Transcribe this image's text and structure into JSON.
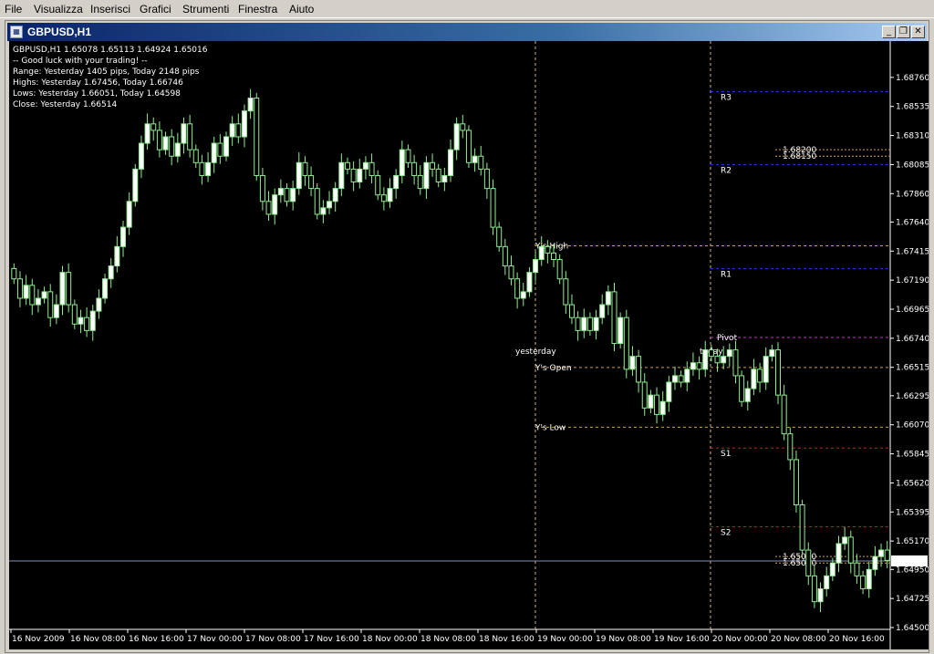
{
  "menu": [
    {
      "label": "File"
    },
    {
      "label": "Visualizza"
    },
    {
      "label": "Inserisci"
    },
    {
      "label": "Grafici"
    },
    {
      "label": "Strumenti"
    },
    {
      "label": "Finestra"
    },
    {
      "label": "Aiuto"
    }
  ],
  "window": {
    "title": "GBPUSD,H1",
    "buttons": {
      "minimize": "_",
      "restore": "❐",
      "close": "✕"
    }
  },
  "info_lines": [
    "GBPUSD,H1  1.65078 1.65113 1.64924 1.65016",
    "-- Good luck with your trading! --",
    "Range: Yesterday 1405 pips, Today 2148 pips",
    "Highs: Yesterday 1.67456, Today 1.66746",
    "Lows:  Yesterday 1.66051, Today 1.64598",
    "Close: Yesterday 1.66514"
  ],
  "colors": {
    "background": "#000000",
    "candle": "#90ee90",
    "bull_body": "#ffffff",
    "resistance": "#1e3cff",
    "support": "#c81e1e",
    "pivot": "#c832c8",
    "yesterday_levels": "#d2a04b",
    "current_price": "#8090c0",
    "separator": "#d2b48c",
    "label_yesterday": "#5f9ea0"
  },
  "chart_data": {
    "type": "candlestick",
    "symbol": "GBPUSD",
    "timeframe": "H1",
    "ylim": [
      1.645,
      1.68985
    ],
    "y_ticks": [
      "1.68760",
      "1.68535",
      "1.68310",
      "1.68085",
      "1.67860",
      "1.67640",
      "1.67415",
      "1.67190",
      "1.66965",
      "1.66740",
      "1.66515",
      "1.66295",
      "1.66070",
      "1.65845",
      "1.65620",
      "1.65395",
      "1.65170",
      "1.64950",
      "1.64725",
      "1.64500"
    ],
    "x_ticks": [
      "16 Nov 2009",
      "16 Nov 08:00",
      "16 Nov 16:00",
      "17 Nov 00:00",
      "17 Nov 08:00",
      "17 Nov 16:00",
      "18 Nov 00:00",
      "18 Nov 08:00",
      "18 Nov 16:00",
      "19 Nov 00:00",
      "19 Nov 08:00",
      "19 Nov 16:00",
      "20 Nov 00:00",
      "20 Nov 08:00",
      "20 Nov 16:00"
    ],
    "last_price": "1.65016",
    "closes": [
      1.672,
      1.6705,
      1.6715,
      1.67,
      1.6705,
      1.671,
      1.669,
      1.67,
      1.6725,
      1.67,
      1.6685,
      1.669,
      1.668,
      1.6695,
      1.6705,
      1.672,
      1.673,
      1.6745,
      1.676,
      1.678,
      1.6805,
      1.6825,
      1.684,
      1.6835,
      1.682,
      1.683,
      1.6815,
      1.6825,
      1.684,
      1.682,
      1.681,
      1.68,
      1.681,
      1.6825,
      1.6815,
      1.683,
      1.684,
      1.683,
      1.685,
      1.686,
      1.68,
      1.678,
      1.677,
      1.6785,
      1.679,
      1.678,
      1.679,
      1.681,
      1.68,
      1.679,
      1.677,
      1.6775,
      1.678,
      1.679,
      1.681,
      1.6805,
      1.6795,
      1.6805,
      1.681,
      1.68,
      1.6785,
      1.678,
      1.679,
      1.68,
      1.682,
      1.681,
      1.68,
      1.679,
      1.681,
      1.6805,
      1.6795,
      1.68,
      1.682,
      1.684,
      1.6835,
      1.681,
      1.6815,
      1.6805,
      1.679,
      1.676,
      1.6745,
      1.673,
      1.672,
      1.6705,
      1.671,
      1.6725,
      1.6735,
      1.6745,
      1.674,
      1.6735,
      1.672,
      1.67,
      1.669,
      1.668,
      1.669,
      1.668,
      1.669,
      1.67,
      1.671,
      1.667,
      1.669,
      1.665,
      1.666,
      1.664,
      1.662,
      1.663,
      1.6615,
      1.6625,
      1.664,
      1.6645,
      1.664,
      1.665,
      1.6655,
      1.665,
      1.6665,
      1.666,
      1.6655,
      1.666,
      1.6665,
      1.6645,
      1.6625,
      1.6635,
      1.665,
      1.664,
      1.666,
      1.6665,
      1.663,
      1.66,
      1.658,
      1.6545,
      1.651,
      1.649,
      1.647,
      1.648,
      1.649,
      1.65,
      1.6515,
      1.652,
      1.65,
      1.649,
      1.648,
      1.6495,
      1.6505,
      1.651,
      1.6502
    ]
  },
  "levels": [
    {
      "label": "R3",
      "value": 1.6865,
      "kind": "resistance"
    },
    {
      "label": "R2",
      "value": 1.68085,
      "kind": "resistance"
    },
    {
      "label": "R1",
      "value": 1.6728,
      "kind": "resistance"
    },
    {
      "label": "Y's High",
      "value": 1.67456,
      "kind": "yesterday"
    },
    {
      "label": "Pivot",
      "value": 1.66746,
      "kind": "pivot"
    },
    {
      "label": "Y's Open",
      "value": 1.66514,
      "kind": "yesterday"
    },
    {
      "label": "Y's Low",
      "value": 1.66051,
      "kind": "yesterday"
    },
    {
      "label": "S1",
      "value": 1.6589,
      "kind": "support"
    },
    {
      "label": "S2",
      "value": 1.6528,
      "kind": "support"
    },
    {
      "label": "1.68200",
      "value": 1.682,
      "kind": "tag"
    },
    {
      "label": "1.68150",
      "value": 1.6815,
      "kind": "tag"
    },
    {
      "label": "1.65050",
      "value": 1.6505,
      "kind": "tag"
    },
    {
      "label": "1.65000",
      "value": 1.65,
      "kind": "tag"
    }
  ],
  "annotations": {
    "yesterday_label": "yesterday",
    "today_label": "today"
  }
}
